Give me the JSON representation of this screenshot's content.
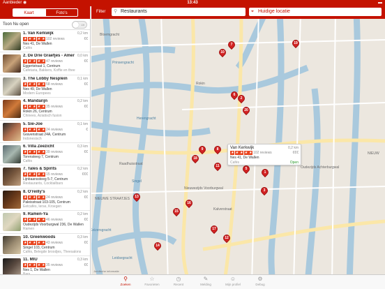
{
  "status": {
    "carrier": "Aanbieder ◉",
    "time": "13:43",
    "battery": "▬"
  },
  "segments": {
    "map": "Kaart",
    "photos": "Foto's"
  },
  "open_now": {
    "label": "Toon Nu open",
    "toggle": "Uit"
  },
  "topbar": {
    "filter": "Filter",
    "search_value": "Restaurants",
    "location_value": "Huidige locatie"
  },
  "restaurants": [
    {
      "name": "1. Van Kerkwijk",
      "distance": "0,2 km",
      "price": "€€",
      "reviews": "102 reviews",
      "address": "Nes 41, De Wallen",
      "category": "Cafés"
    },
    {
      "name": "2. De Drie Graefjes - American Bakery",
      "distance": "0,0 km",
      "price": "€€",
      "reviews": "47 reviews",
      "address": "Eggertstraat 1, Centrum",
      "category": "Cafetaria, Bakkers, Koffie en thee"
    },
    {
      "name": "3. The Lobby Nesplein",
      "distance": "0,1 km",
      "price": "€€",
      "reviews": "58 reviews",
      "address": "Nes 49, De Wallen",
      "category": "Modern Europees"
    },
    {
      "name": "4. Mandarijn",
      "distance": "0,2 km",
      "price": "€€",
      "reviews": "35 reviews",
      "address": "Rokin 26, Centrum",
      "category": "Chinees, Aziatisch fusion"
    },
    {
      "name": "5. Sie-Joe",
      "distance": "0,1 km",
      "price": "€",
      "reviews": "24 reviews",
      "address": "Gravenstraat 24A, Centrum",
      "category": "Indonesisch"
    },
    {
      "name": "6. Villa Zeezicht",
      "distance": "0,3 km",
      "price": "€€",
      "reviews": "39 reviews",
      "address": "Torensteeg 7, Centrum",
      "category": "Cafés"
    },
    {
      "name": "7. Tales & Spirits",
      "distance": "0,2 km",
      "price": "€€€",
      "reviews": "15 reviews",
      "address": "Lijnbaanssteeg 5-7, Centrum",
      "category": "Restaurants, Cocktailbars"
    },
    {
      "name": "8. O'reilly's",
      "distance": "0,2 km",
      "price": "€€",
      "reviews": "24 reviews",
      "address": "Paleisstraat 103-105, Centrum",
      "category": "Eetcafés, Ierse, Kroegen"
    },
    {
      "name": "9. Ramen-Ya",
      "distance": "0,2 km",
      "price": "€€",
      "reviews": "46 reviews",
      "address": "Oudezijds Voorburgwal 236, De Wallen",
      "category": "Ramen"
    },
    {
      "name": "10. Greenwoods",
      "distance": "0,3 km",
      "price": "€€",
      "reviews": "43 reviews",
      "address": "Singel 103, Centrum",
      "category": "Cafés, Belegde broodjes, Theesalons"
    },
    {
      "name": "11. MIU",
      "distance": "0,3 km",
      "price": "€€",
      "reviews": "35 reviews",
      "address": "Nes 1, De Wallen",
      "category": "Bars"
    }
  ],
  "callout": {
    "name": "Van Kerkwijk",
    "distance": "0,2 km",
    "price": "€€€",
    "reviews": "102 reviews",
    "address": "Nes 41, De Wallen",
    "category": "Cafés",
    "status": "Open"
  },
  "map_labels": [
    "NIEUWE STRAATJES",
    "Singel",
    "Herengracht",
    "Keizersgracht",
    "Prinsengracht",
    "Rokin",
    "Raadhuisstraat",
    "Nieuwezijds Voorburgwal",
    "Kalverstraat",
    "Oudezijds Achterburgwal",
    "NIEUW",
    "Bloemgracht",
    "Leidsegracht"
  ],
  "map_pins": [
    "19",
    "7",
    "10",
    "6",
    "2",
    "20",
    "9",
    "4",
    "8",
    "11",
    "18",
    "5",
    "3",
    "1",
    "16",
    "15",
    "17",
    "12",
    "13",
    "14"
  ],
  "legal": "Juridische informatie",
  "tabs": [
    {
      "label": "Zoeken",
      "icon": "⚲"
    },
    {
      "label": "Favorieten",
      "icon": "☆"
    },
    {
      "label": "Recent",
      "icon": "◷"
    },
    {
      "label": "Melding",
      "icon": "✎"
    },
    {
      "label": "Mijn profiel",
      "icon": "☺"
    },
    {
      "label": "Debug",
      "icon": "⚙"
    }
  ],
  "colors": {
    "brand": "#c41200",
    "pin": "#d32323",
    "star": "#e8441e",
    "open": "#2a9a2a"
  }
}
